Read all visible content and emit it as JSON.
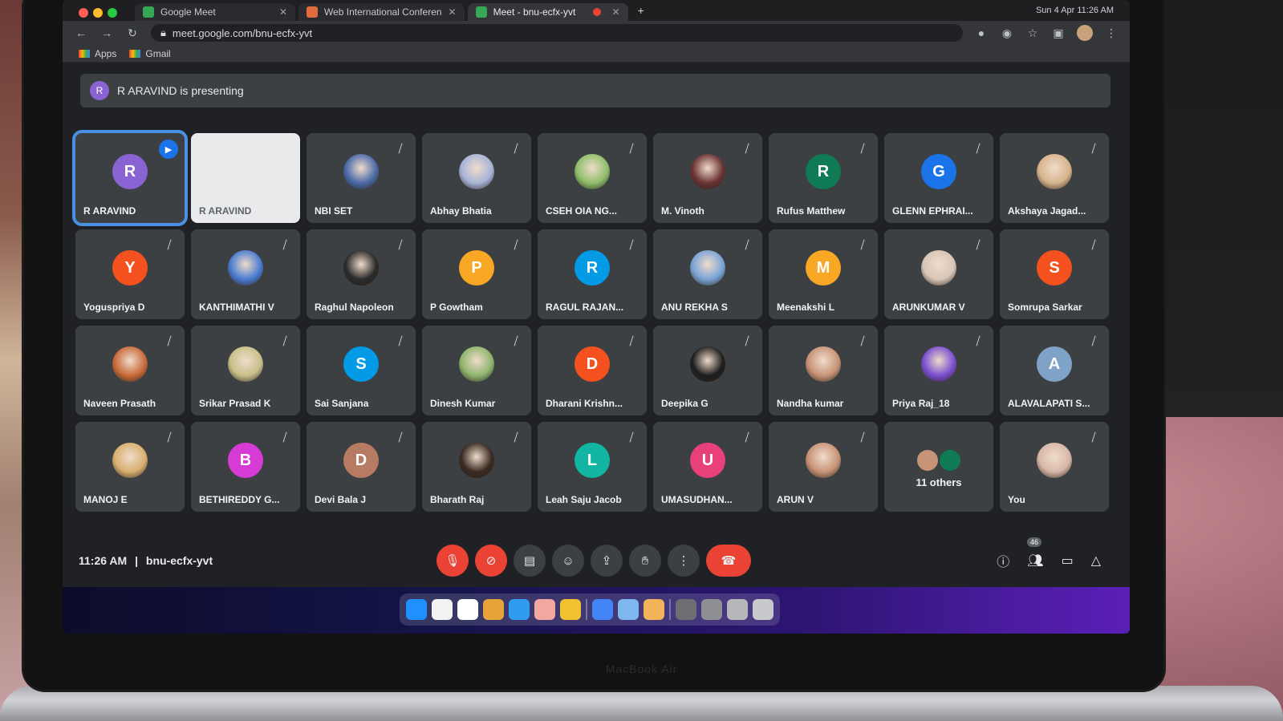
{
  "browser": {
    "tabs": [
      {
        "label": "Google Meet",
        "active": false
      },
      {
        "label": "Web International Conferen",
        "active": false
      },
      {
        "label": "Meet - bnu-ecfx-yvt",
        "active": true
      }
    ],
    "new_tab": "+",
    "clock": "Sun 4 Apr 11:26 AM",
    "url": "meet.google.com/bnu-ecfx-yvt",
    "bookmarks": [
      "Apps",
      "Gmail"
    ]
  },
  "banner": {
    "initial": "R",
    "text": "R ARAVIND is presenting"
  },
  "participants": [
    {
      "name": "R ARAVIND",
      "initial": "R",
      "color": "#8a63d2",
      "type": "letter",
      "active": true,
      "presenting": true
    },
    {
      "name": "R ARAVIND",
      "initial": "",
      "color": "#e9eaec",
      "type": "share"
    },
    {
      "name": "NBI SET",
      "initial": "",
      "color": "#4b6aa8",
      "type": "photo"
    },
    {
      "name": "Abhay Bhatia",
      "initial": "",
      "color": "#a7b4d8",
      "type": "photo"
    },
    {
      "name": "CSEH OIA NG...",
      "initial": "",
      "color": "#8fbf6a",
      "type": "photo"
    },
    {
      "name": "M. Vinoth",
      "initial": "",
      "color": "#6b3434",
      "type": "photo"
    },
    {
      "name": "Rufus Matthew",
      "initial": "R",
      "color": "#0f7b55",
      "type": "letter"
    },
    {
      "name": "GLENN EPHRAI...",
      "initial": "G",
      "color": "#1a73e8",
      "type": "letter"
    },
    {
      "name": "Akshaya Jagad...",
      "initial": "",
      "color": "#d7b48e",
      "type": "photo"
    },
    {
      "name": "Yoguspriya D",
      "initial": "Y",
      "color": "#f4511e",
      "type": "letter"
    },
    {
      "name": "KANTHIMATHI V",
      "initial": "",
      "color": "#4a7bd0",
      "type": "photo"
    },
    {
      "name": "Raghul Napoleon",
      "initial": "",
      "color": "#2b2b2b",
      "type": "photo"
    },
    {
      "name": "P Gowtham",
      "initial": "P",
      "color": "#f9a825",
      "type": "letter"
    },
    {
      "name": "RAGUL RAJAN...",
      "initial": "R",
      "color": "#039be5",
      "type": "letter"
    },
    {
      "name": "ANU REKHA S",
      "initial": "",
      "color": "#7aa4d6",
      "type": "photo"
    },
    {
      "name": "Meenakshi L",
      "initial": "M",
      "color": "#f9a825",
      "type": "letter"
    },
    {
      "name": "ARUNKUMAR V",
      "initial": "",
      "color": "#d8c6b8",
      "type": "photo"
    },
    {
      "name": "Somrupa Sarkar",
      "initial": "S",
      "color": "#f4511e",
      "type": "letter"
    },
    {
      "name": "Naveen Prasath",
      "initial": "",
      "color": "#c96b3a",
      "type": "photo"
    },
    {
      "name": "Srikar Prasad K",
      "initial": "",
      "color": "#c8c08a",
      "type": "photo"
    },
    {
      "name": "Sai Sanjana",
      "initial": "S",
      "color": "#039be5",
      "type": "letter"
    },
    {
      "name": "Dinesh Kumar",
      "initial": "",
      "color": "#8fb56e",
      "type": "photo"
    },
    {
      "name": "Dharani Krishn...",
      "initial": "D",
      "color": "#f4511e",
      "type": "letter"
    },
    {
      "name": "Deepika G",
      "initial": "",
      "color": "#1e1e1e",
      "type": "photo"
    },
    {
      "name": "Nandha kumar",
      "initial": "",
      "color": "#c89478",
      "type": "photo"
    },
    {
      "name": "Priya Raj_18",
      "initial": "",
      "color": "#7b4fd0",
      "type": "photo"
    },
    {
      "name": "ALAVALAPATI S...",
      "initial": "A",
      "color": "#7fa3c6",
      "type": "letter"
    },
    {
      "name": "MANOJ E",
      "initial": "",
      "color": "#d8b070",
      "type": "photo"
    },
    {
      "name": "BETHIREDDY G...",
      "initial": "B",
      "color": "#d63bd6",
      "type": "letter"
    },
    {
      "name": "Devi Bala J",
      "initial": "D",
      "color": "#b77a62",
      "type": "letter"
    },
    {
      "name": "Bharath Raj",
      "initial": "",
      "color": "#3a2a22",
      "type": "photo"
    },
    {
      "name": "Leah Saju Jacob",
      "initial": "L",
      "color": "#12b5a2",
      "type": "letter"
    },
    {
      "name": "UMASUDHAN...",
      "initial": "U",
      "color": "#e8407a",
      "type": "letter"
    },
    {
      "name": "ARUN V",
      "initial": "",
      "color": "#c89478",
      "type": "photo"
    },
    {
      "name": "11 others",
      "initial": "",
      "color": "#3c4043",
      "type": "others"
    },
    {
      "name": "You",
      "initial": "",
      "color": "#d8b8a8",
      "type": "photo"
    }
  ],
  "controls": {
    "time": "11:26 AM",
    "separator": "|",
    "meeting_code": "bnu-ecfx-yvt",
    "people_count": "46",
    "mic_icon": "mic-off-icon",
    "cam_icon": "cam-off-icon",
    "end_call_icon": "phone-hangup-icon"
  }
}
